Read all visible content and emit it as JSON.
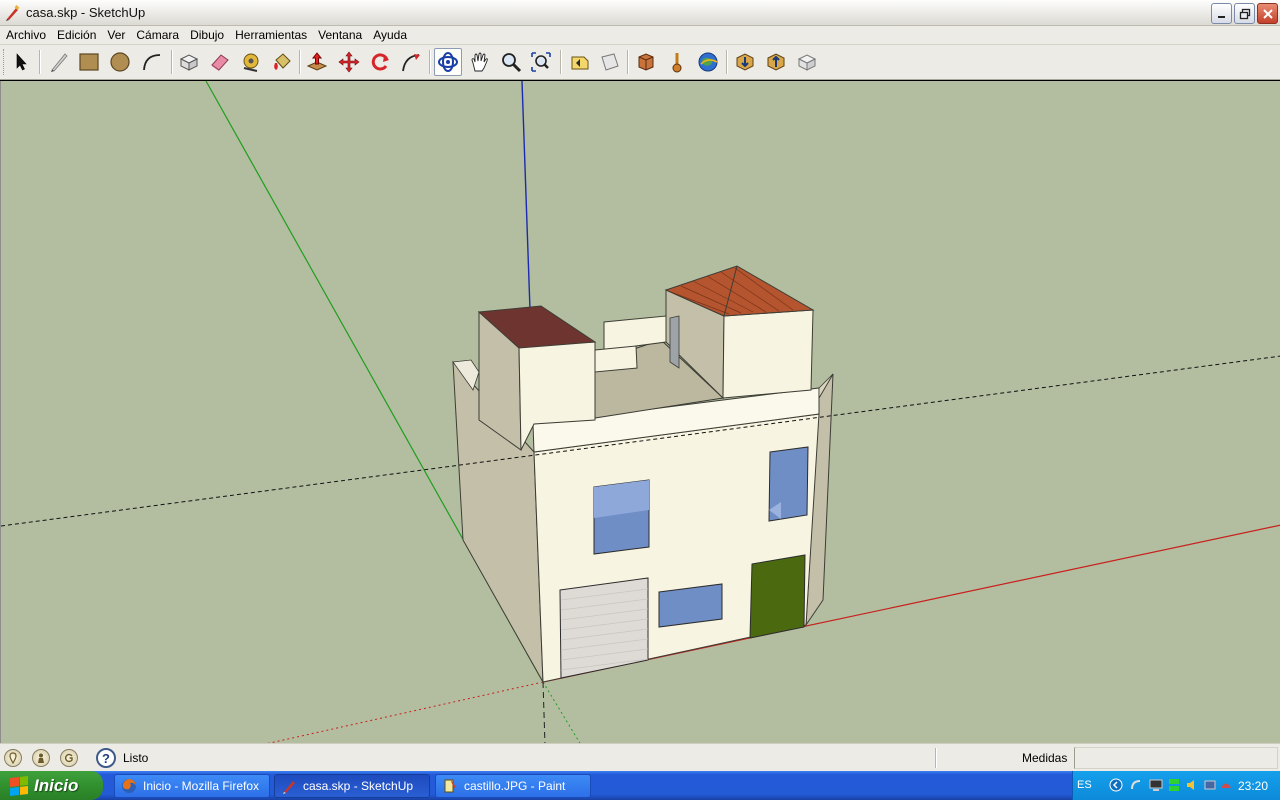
{
  "window": {
    "title": "casa.skp - SketchUp",
    "controls": [
      "minimize",
      "restore",
      "close"
    ]
  },
  "menu": {
    "items": [
      "Archivo",
      "Edición",
      "Ver",
      "Cámara",
      "Dibujo",
      "Herramientas",
      "Ventana",
      "Ayuda"
    ]
  },
  "toolbar": {
    "tools": [
      {
        "name": "select-tool-icon"
      },
      {
        "name": "pencil-tool-icon"
      },
      {
        "name": "rectangle-tool-icon"
      },
      {
        "name": "circle-tool-icon"
      },
      {
        "name": "arc-tool-icon"
      },
      {
        "name": "make-component-icon"
      },
      {
        "name": "eraser-tool-icon"
      },
      {
        "name": "tape-measure-tool-icon"
      },
      {
        "name": "paint-bucket-tool-icon"
      },
      {
        "name": "push-pull-tool-icon"
      },
      {
        "name": "move-tool-icon"
      },
      {
        "name": "rotate-tool-icon"
      },
      {
        "name": "follow-me-tool-icon"
      },
      {
        "name": "orbit-tool-icon",
        "active": true
      },
      {
        "name": "pan-tool-icon"
      },
      {
        "name": "zoom-tool-icon"
      },
      {
        "name": "zoom-extents-icon"
      },
      {
        "name": "previous-view-icon"
      },
      {
        "name": "next-view-icon"
      },
      {
        "name": "get-models-icon"
      },
      {
        "name": "place-model-icon"
      },
      {
        "name": "google-earth-icon"
      },
      {
        "name": "get-current-view-icon"
      },
      {
        "name": "share-model-icon"
      },
      {
        "name": "share-component-icon"
      }
    ]
  },
  "statusbar": {
    "status_text": "Listo",
    "measure_label": "Medidas",
    "measure_value": ""
  },
  "taskbar": {
    "start_label": "Inicio",
    "tasks": [
      {
        "label": "Inicio - Mozilla Firefox",
        "active": false
      },
      {
        "label": "casa.skp - SketchUp",
        "active": true
      },
      {
        "label": "castillo.JPG - Paint",
        "active": false
      }
    ],
    "tray_lang": "ES",
    "clock": "23:20"
  },
  "colors": {
    "viewport_bg": "#b3bea1",
    "wall_front": "#f7f4e1",
    "wall_side": "#c3bfa9",
    "window_glass": "#6f8ec6",
    "door_green": "#4b6a10",
    "roof_tile": "#b5552f",
    "roof_flat": "#6e3530",
    "axis_red": "#c8201c",
    "axis_green": "#1f9e1f",
    "axis_blue": "#1c2ab0"
  }
}
